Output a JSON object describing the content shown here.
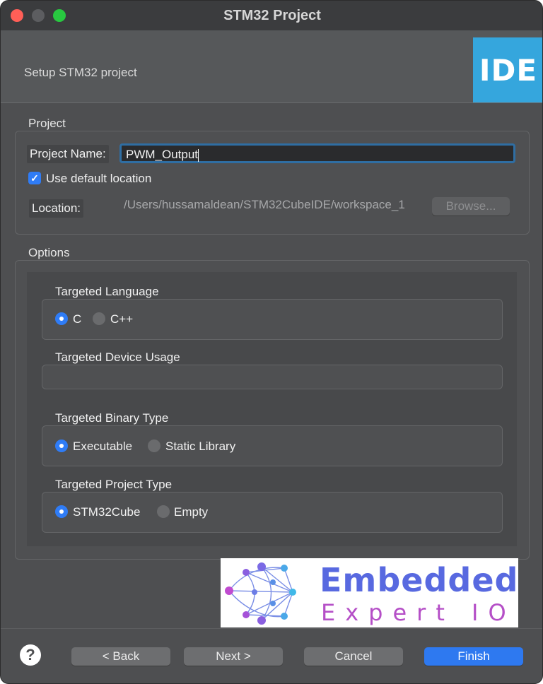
{
  "window": {
    "title": "STM32 Project"
  },
  "header": {
    "subtitle": "Setup STM32 project",
    "logo_text": "IDE"
  },
  "project": {
    "section_label": "Project",
    "name_label": "Project Name:",
    "name_value": "PWM_Output",
    "use_default_label": "Use default location",
    "use_default_checked": true,
    "location_label": "Location:",
    "location_value": "/Users/hussamaldean/STM32CubeIDE/workspace_1",
    "browse_label": "Browse..."
  },
  "options": {
    "section_label": "Options",
    "language": {
      "label": "Targeted Language",
      "options": [
        "C",
        "C++"
      ],
      "selected": "C"
    },
    "device_usage": {
      "label": "Targeted Device Usage"
    },
    "binary": {
      "label": "Targeted Binary Type",
      "options": [
        "Executable",
        "Static Library"
      ],
      "selected": "Executable"
    },
    "project_type": {
      "label": "Targeted Project Type",
      "options": [
        "STM32Cube",
        "Empty"
      ],
      "selected": "STM32Cube"
    }
  },
  "brand": {
    "line1": "Embedded",
    "line2": "Expert IO"
  },
  "footer": {
    "help_icon": "question-icon",
    "back_label": "< Back",
    "next_label": "Next >",
    "cancel_label": "Cancel",
    "finish_label": "Finish"
  },
  "colors": {
    "accent": "#2e79f0",
    "logo_bg": "#35a6dd",
    "brand_blue": "#5869e0",
    "brand_purple": "#b54fc7"
  }
}
